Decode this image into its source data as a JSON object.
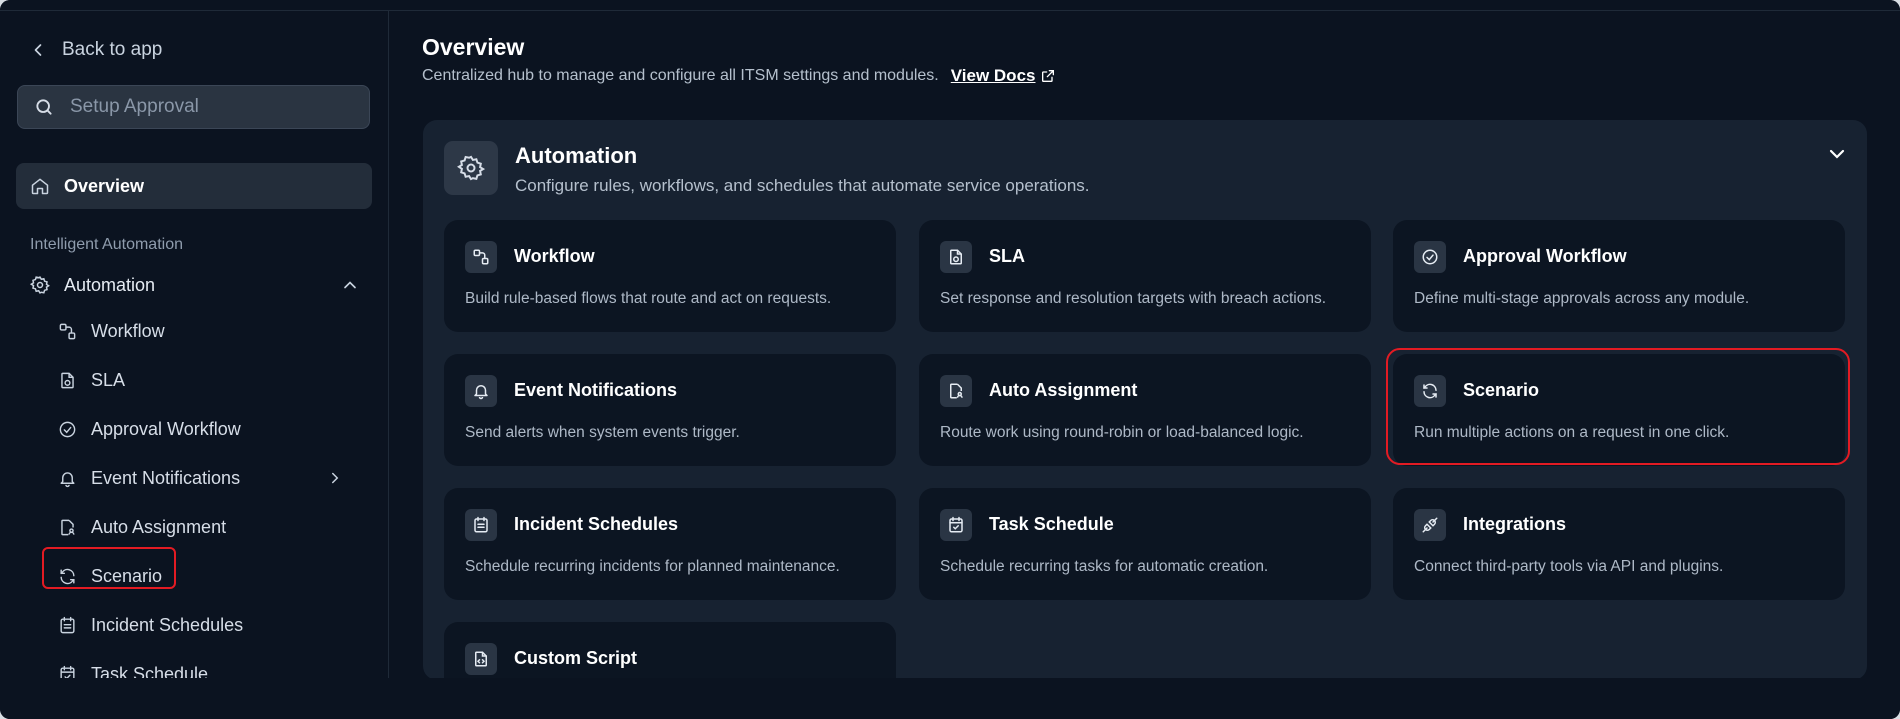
{
  "sidebar": {
    "back_label": "Back to app",
    "search_placeholder": "Setup Approval",
    "overview_label": "Overview",
    "section_label": "Intelligent Automation",
    "automation_label": "Automation",
    "items": [
      {
        "label": "Workflow",
        "icon": "workflow-icon"
      },
      {
        "label": "SLA",
        "icon": "sla-icon"
      },
      {
        "label": "Approval Workflow",
        "icon": "check-circle-icon"
      },
      {
        "label": "Event Notifications",
        "icon": "bell-icon"
      },
      {
        "label": "Auto Assignment",
        "icon": "file-user-icon"
      },
      {
        "label": "Scenario",
        "icon": "refresh-icon"
      },
      {
        "label": "Incident Schedules",
        "icon": "calendar-list-icon"
      },
      {
        "label": "Task Schedule",
        "icon": "calendar-check-icon"
      }
    ]
  },
  "main": {
    "title": "Overview",
    "subtitle": "Centralized hub to manage and configure all ITSM settings and modules.",
    "view_docs": "View Docs",
    "panel": {
      "title": "Automation",
      "description": "Configure rules, workflows, and schedules that automate service operations.",
      "cards": [
        {
          "title": "Workflow",
          "desc": "Build rule-based flows that route and act on requests.",
          "icon": "workflow-icon"
        },
        {
          "title": "SLA",
          "desc": "Set response and resolution targets with breach actions.",
          "icon": "sla-icon"
        },
        {
          "title": "Approval Workflow",
          "desc": "Define multi-stage approvals across any module.",
          "icon": "check-circle-icon"
        },
        {
          "title": "Event Notifications",
          "desc": "Send alerts when system events trigger.",
          "icon": "bell-icon"
        },
        {
          "title": "Auto Assignment",
          "desc": "Route work using round-robin or load-balanced logic.",
          "icon": "file-user-icon"
        },
        {
          "title": "Scenario",
          "desc": "Run multiple actions on a request in one click.",
          "icon": "refresh-icon"
        },
        {
          "title": "Incident Schedules",
          "desc": "Schedule recurring incidents for planned maintenance.",
          "icon": "calendar-list-icon"
        },
        {
          "title": "Task Schedule",
          "desc": "Schedule recurring tasks for automatic creation.",
          "icon": "calendar-check-icon"
        },
        {
          "title": "Integrations",
          "desc": "Connect third-party tools via API and plugins.",
          "icon": "plug-icon"
        },
        {
          "title": "Custom Script",
          "desc": "",
          "icon": "script-icon"
        }
      ]
    }
  },
  "colors": {
    "background": "#0b1320",
    "panel": "#172231",
    "card": "#0c1522",
    "highlight": "#e31b23"
  }
}
